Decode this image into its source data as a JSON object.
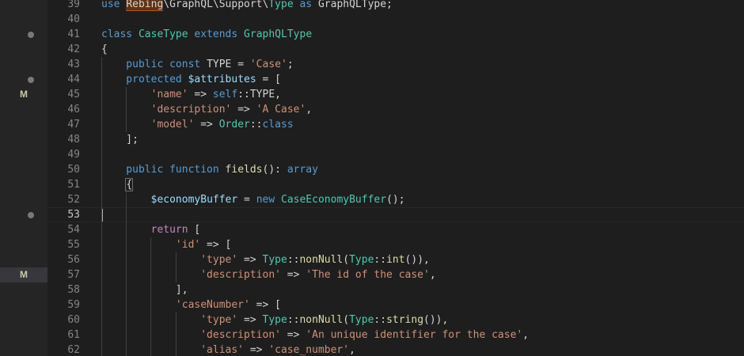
{
  "gutter": {
    "dots": [
      2,
      5,
      14
    ],
    "marks": [
      {
        "row": 6,
        "label": "M",
        "active": false
      },
      {
        "row": 18,
        "label": "M",
        "active": true
      }
    ]
  },
  "editor": {
    "first_line": 39,
    "current_line": 53,
    "lines": [
      {
        "n": "39",
        "tokens": [
          {
            "t": "use ",
            "c": "kw"
          },
          {
            "t": "Rebing",
            "c": "hl"
          },
          {
            "t": "\\GraphQL\\Support\\",
            "c": "plain"
          },
          {
            "t": "Type",
            "c": "type"
          },
          {
            "t": " as ",
            "c": "kw"
          },
          {
            "t": "GraphQLType;",
            "c": "plain"
          }
        ]
      },
      {
        "n": "40",
        "tokens": []
      },
      {
        "n": "41",
        "tokens": [
          {
            "t": "class ",
            "c": "kw"
          },
          {
            "t": "CaseType",
            "c": "type"
          },
          {
            "t": " extends ",
            "c": "kw"
          },
          {
            "t": "GraphQLType",
            "c": "type"
          }
        ]
      },
      {
        "n": "42",
        "tokens": [
          {
            "t": "{",
            "c": "plain"
          }
        ]
      },
      {
        "n": "43",
        "tokens": [
          {
            "t": "    public const ",
            "c": "kw"
          },
          {
            "t": "TYPE = ",
            "c": "plain"
          },
          {
            "t": "'Case'",
            "c": "str"
          },
          {
            "t": ";",
            "c": "plain"
          }
        ]
      },
      {
        "n": "44",
        "tokens": [
          {
            "t": "    protected ",
            "c": "kw"
          },
          {
            "t": "$attributes",
            "c": "var"
          },
          {
            "t": " = [",
            "c": "plain"
          }
        ]
      },
      {
        "n": "45",
        "tokens": [
          {
            "t": "        'name'",
            "c": "str"
          },
          {
            "t": " => ",
            "c": "plain"
          },
          {
            "t": "self",
            "c": "kw"
          },
          {
            "t": "::",
            "c": "plain"
          },
          {
            "t": "TYPE,",
            "c": "plain"
          }
        ]
      },
      {
        "n": "46",
        "tokens": [
          {
            "t": "        'description'",
            "c": "str"
          },
          {
            "t": " => ",
            "c": "plain"
          },
          {
            "t": "'A Case'",
            "c": "str"
          },
          {
            "t": ",",
            "c": "plain"
          }
        ]
      },
      {
        "n": "47",
        "tokens": [
          {
            "t": "        'model'",
            "c": "str"
          },
          {
            "t": " => ",
            "c": "plain"
          },
          {
            "t": "Order",
            "c": "type"
          },
          {
            "t": "::",
            "c": "plain"
          },
          {
            "t": "class",
            "c": "kw"
          }
        ]
      },
      {
        "n": "48",
        "tokens": [
          {
            "t": "    ];",
            "c": "plain"
          }
        ]
      },
      {
        "n": "49",
        "tokens": []
      },
      {
        "n": "50",
        "tokens": [
          {
            "t": "    public function ",
            "c": "kw"
          },
          {
            "t": "fields",
            "c": "fn"
          },
          {
            "t": "(): ",
            "c": "plain"
          },
          {
            "t": "array",
            "c": "kw"
          }
        ]
      },
      {
        "n": "51",
        "tokens": [
          {
            "t": "    ",
            "c": "plain"
          },
          {
            "t": "{",
            "c": "brk"
          }
        ]
      },
      {
        "n": "52",
        "tokens": [
          {
            "t": "        ",
            "c": "plain"
          },
          {
            "t": "$economyBuffer",
            "c": "var"
          },
          {
            "t": " = ",
            "c": "plain"
          },
          {
            "t": "new ",
            "c": "kw"
          },
          {
            "t": "CaseEconomyBuffer",
            "c": "type"
          },
          {
            "t": "();",
            "c": "plain"
          }
        ]
      },
      {
        "n": "53",
        "tokens": []
      },
      {
        "n": "54",
        "tokens": [
          {
            "t": "        ",
            "c": "plain"
          },
          {
            "t": "return",
            "c": "ctl"
          },
          {
            "t": " [",
            "c": "plain"
          }
        ]
      },
      {
        "n": "55",
        "tokens": [
          {
            "t": "            'id'",
            "c": "str"
          },
          {
            "t": " => [",
            "c": "plain"
          }
        ]
      },
      {
        "n": "56",
        "tokens": [
          {
            "t": "                'type'",
            "c": "str"
          },
          {
            "t": " => ",
            "c": "plain"
          },
          {
            "t": "Type",
            "c": "type"
          },
          {
            "t": "::",
            "c": "plain"
          },
          {
            "t": "nonNull",
            "c": "fn"
          },
          {
            "t": "(",
            "c": "plain"
          },
          {
            "t": "Type",
            "c": "type"
          },
          {
            "t": "::",
            "c": "plain"
          },
          {
            "t": "int",
            "c": "fn"
          },
          {
            "t": "()),",
            "c": "plain"
          }
        ]
      },
      {
        "n": "57",
        "tokens": [
          {
            "t": "                'description'",
            "c": "str"
          },
          {
            "t": " => ",
            "c": "plain"
          },
          {
            "t": "'The id of the case'",
            "c": "str"
          },
          {
            "t": ",",
            "c": "plain"
          }
        ]
      },
      {
        "n": "58",
        "tokens": [
          {
            "t": "            ],",
            "c": "plain"
          }
        ]
      },
      {
        "n": "59",
        "tokens": [
          {
            "t": "            'caseNumber'",
            "c": "str"
          },
          {
            "t": " => [",
            "c": "plain"
          }
        ]
      },
      {
        "n": "60",
        "tokens": [
          {
            "t": "                'type'",
            "c": "str"
          },
          {
            "t": " => ",
            "c": "plain"
          },
          {
            "t": "Type",
            "c": "type"
          },
          {
            "t": "::",
            "c": "plain"
          },
          {
            "t": "nonNull",
            "c": "fn"
          },
          {
            "t": "(",
            "c": "plain"
          },
          {
            "t": "Type",
            "c": "type"
          },
          {
            "t": "::",
            "c": "plain"
          },
          {
            "t": "string",
            "c": "fn"
          },
          {
            "t": "()),",
            "c": "plain"
          }
        ]
      },
      {
        "n": "61",
        "tokens": [
          {
            "t": "                'description'",
            "c": "str"
          },
          {
            "t": " => ",
            "c": "plain"
          },
          {
            "t": "'An unique identifier for the case'",
            "c": "str"
          },
          {
            "t": ",",
            "c": "plain"
          }
        ]
      },
      {
        "n": "62",
        "tokens": [
          {
            "t": "                'alias'",
            "c": "str"
          },
          {
            "t": " => ",
            "c": "plain"
          },
          {
            "t": "'case_number'",
            "c": "str"
          },
          {
            "t": ",",
            "c": "plain"
          }
        ]
      }
    ]
  },
  "colors": {
    "background": "#1e1e1e",
    "gutter": "#252526",
    "keyword": "#569cd6",
    "string": "#ce9178",
    "type": "#4ec9b0",
    "function": "#dcdcaa",
    "variable": "#9cdcfe",
    "control": "#c586c0"
  }
}
